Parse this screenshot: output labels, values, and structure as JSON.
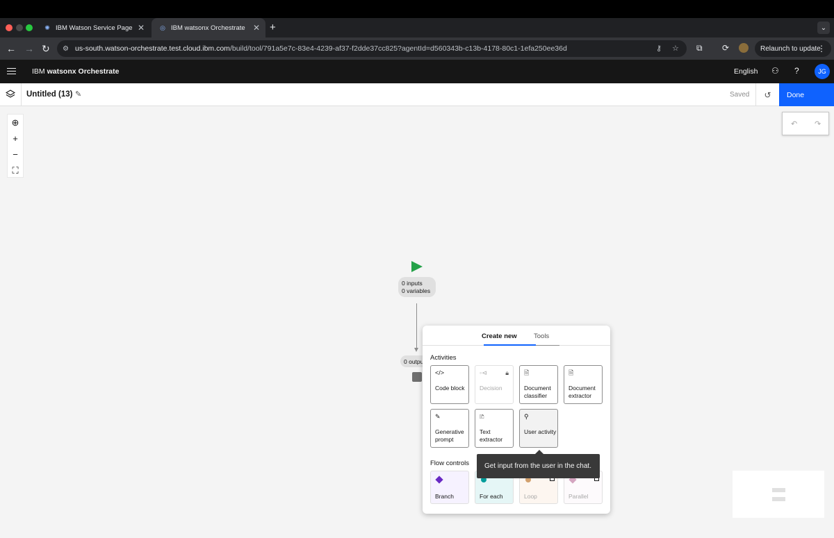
{
  "browser": {
    "tabs": [
      {
        "title": "IBM Watson Service Page",
        "active": false
      },
      {
        "title": "IBM watsonx Orchestrate",
        "active": true
      }
    ],
    "url_host": "us-south.watson-orchestrate.test.cloud.ibm.com",
    "url_path": "/build/tool/791a5e7c-83e4-4239-af37-f2dde37cc825?agentId=d560343b-c13b-4178-80c1-1efa250ee36d",
    "relaunch_label": "Relaunch to update"
  },
  "app": {
    "brand_prefix": "IBM ",
    "brand_name": "watsonx Orchestrate",
    "language": "English",
    "user_initials": "JG"
  },
  "toolbar": {
    "title": "Untitled (13)",
    "status": "Saved",
    "done_label": "Done"
  },
  "canvas": {
    "start_inputs": "0 inputs",
    "start_variables": "0 variables",
    "end_outputs": "0 outputs"
  },
  "palette": {
    "tabs": [
      "Create new",
      "Tools"
    ],
    "active_tab": "Create new",
    "activities_heading": "Activities",
    "activities": [
      {
        "label": "Code block",
        "icon": "code-icon",
        "enabled": true
      },
      {
        "label": "Decision",
        "icon": "decision-icon",
        "enabled": false
      },
      {
        "label": "Document classifier",
        "icon": "document-classifier-icon",
        "enabled": true
      },
      {
        "label": "Document extractor",
        "icon": "document-extractor-icon",
        "enabled": true
      },
      {
        "label": "Generative prompt",
        "icon": "pen-icon",
        "enabled": true
      },
      {
        "label": "Text extractor",
        "icon": "text-extractor-icon",
        "enabled": true
      },
      {
        "label": "User activity",
        "icon": "user-icon",
        "enabled": true
      }
    ],
    "flow_heading": "Flow controls",
    "flow_controls": [
      {
        "label": "Branch",
        "color": "#6929c4",
        "bg": "#f6f2ff"
      },
      {
        "label": "For each",
        "color": "#009d9a",
        "bg": "#e5f6f6"
      },
      {
        "label": "Loop",
        "color": "#d2a06d",
        "bg": "#fdf6f0"
      },
      {
        "label": "Parallel",
        "color": "#d4a5c0",
        "bg": "#fdfafc"
      }
    ],
    "tooltip": "Get input from the user in the chat."
  },
  "colors": {
    "accent": "#0f62fe",
    "start": "#24a148"
  }
}
